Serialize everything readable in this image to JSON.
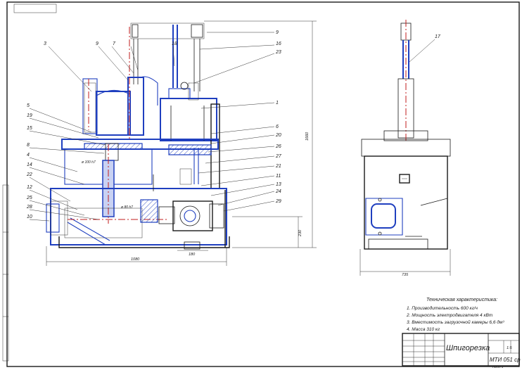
{
  "drawing": {
    "title": "Шпигорезка",
    "code": "МТИ 051 ср",
    "scale": "1:5",
    "sheet": "Лист 1"
  },
  "specs": {
    "heading": "Техническая характеристика:",
    "lines": [
      "1. Производительность 600 кг/ч",
      "2. Мощность электродвигателя 4 кВт",
      "3. Вместимость загрузочной камеры 6,6 дм³",
      "4. Масса 310 кг"
    ]
  },
  "dimensions": {
    "overall_width": "1080",
    "overall_height": "1660",
    "base_height": "230",
    "foot_width": "180",
    "side_width": "735",
    "shaft_a": "ø 100 h7",
    "shaft_b": "ø 80 h7"
  },
  "callouts_left": [
    "3",
    "5",
    "19",
    "15",
    "8",
    "4",
    "14",
    "22",
    "12",
    "25",
    "28",
    "10"
  ],
  "callouts_top": [
    "9",
    "7",
    "18",
    "9",
    "16",
    "23",
    "1"
  ],
  "callouts_right": [
    "6",
    "20",
    "26",
    "27",
    "21",
    "11",
    "13",
    "24",
    "29"
  ],
  "callout_side": "17"
}
